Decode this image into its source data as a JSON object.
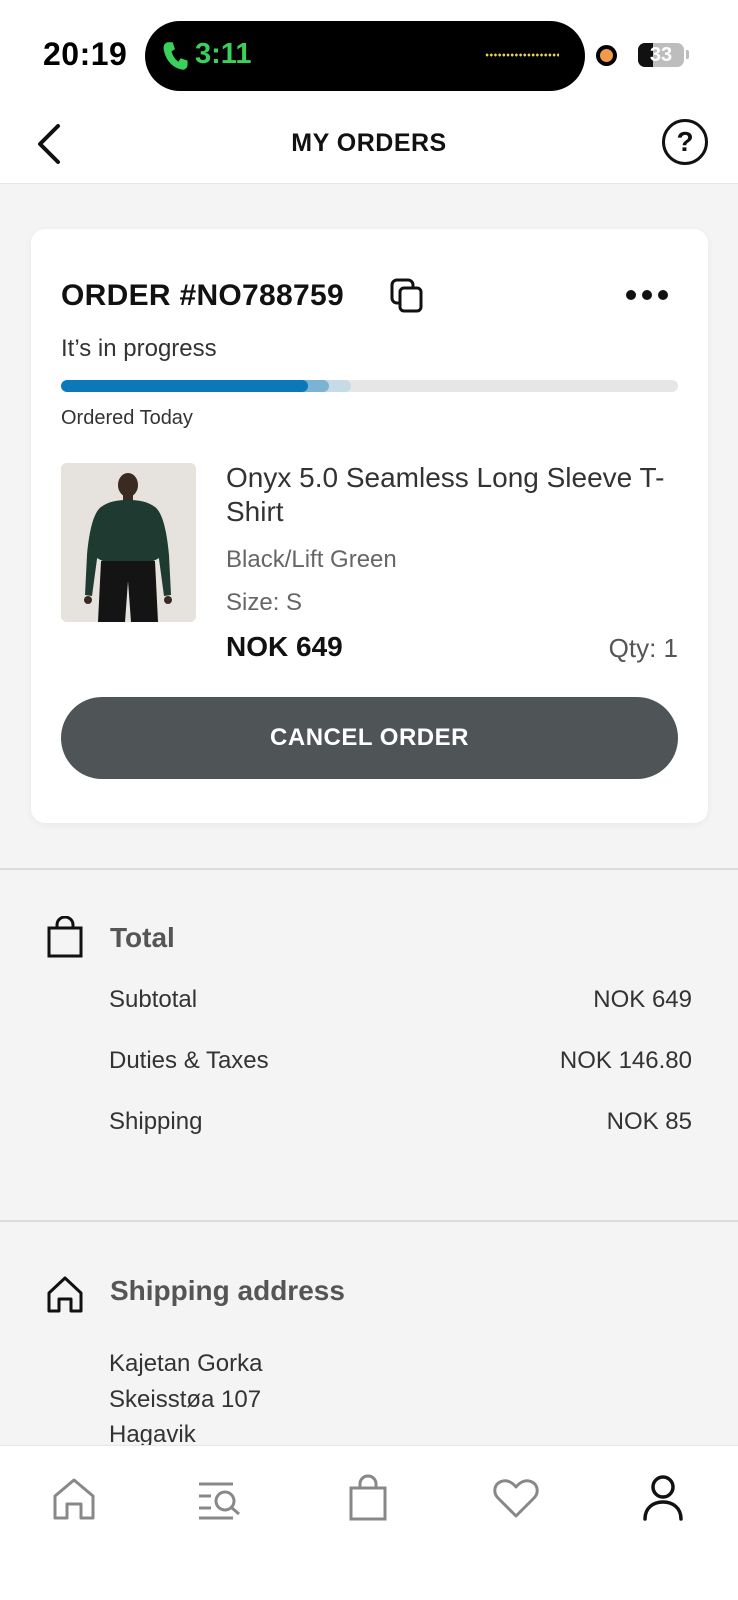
{
  "status_bar": {
    "time": "20:19",
    "call_time": "3:11",
    "battery_level": "33",
    "battery_fraction": 0.33,
    "call_color": "#3ad15a"
  },
  "header": {
    "title": "MY ORDERS",
    "back_icon": "chevron-left-icon",
    "help_label": "?"
  },
  "order": {
    "number_label": "ORDER #NO788759",
    "status_text": "It’s in progress",
    "progress_fraction": 0.4,
    "ordered_text": "Ordered Today",
    "accent_color": "#0b79b9",
    "item": {
      "name": "Onyx 5.0 Seamless Long Sleeve T-Shirt",
      "color": "Black/Lift Green",
      "size": "Size: S",
      "price": "NOK 649",
      "qty": "Qty: 1"
    },
    "cancel_label": "CANCEL ORDER"
  },
  "totals": {
    "title": "Total",
    "rows": [
      {
        "label": "Subtotal",
        "value": "NOK 649"
      },
      {
        "label": "Duties & Taxes",
        "value": "NOK 146.80"
      },
      {
        "label": "Shipping",
        "value": "NOK 85"
      }
    ]
  },
  "shipping": {
    "title": "Shipping address",
    "lines": [
      "Kajetan Gorka",
      "Skeisstøa 107",
      "Hagavik"
    ]
  },
  "tab_bar": {
    "items": [
      "home-icon",
      "search-list-icon",
      "bag-icon",
      "heart-icon",
      "account-icon"
    ],
    "active": "account-icon"
  }
}
